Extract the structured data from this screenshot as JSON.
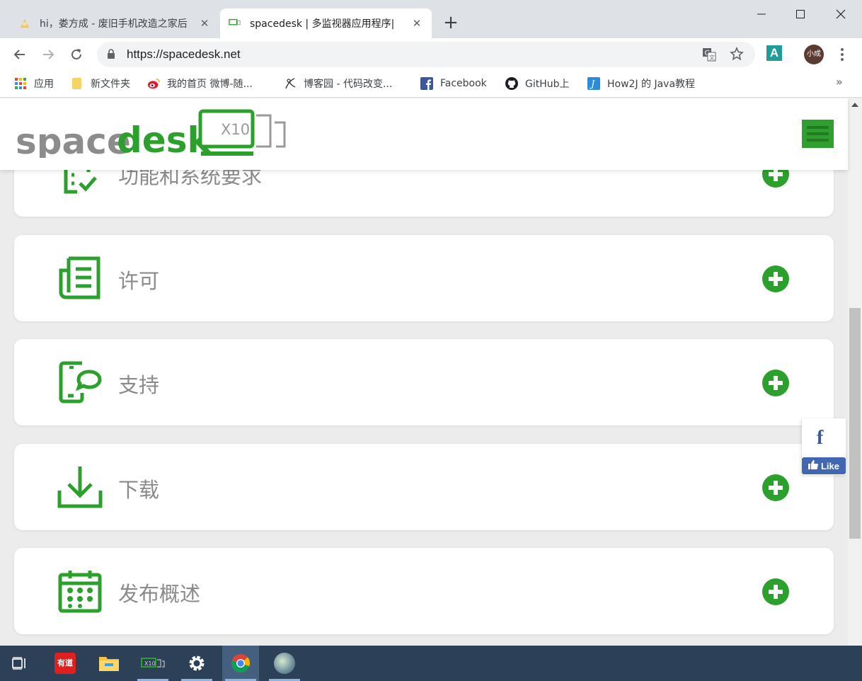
{
  "browser": {
    "tabs": [
      {
        "title": "hi，娄方成 - 废旧手机改造之家后",
        "active": false
      },
      {
        "title": "spacedesk | 多监视器应用程序|",
        "active": true
      }
    ],
    "new_tab_label": "+",
    "address": "https://spacedesk.net",
    "profile_label": "小成",
    "extension_label": "A",
    "bookmarks": [
      {
        "label": "应用",
        "icon": "apps-grid-icon"
      },
      {
        "label": "新文件夹",
        "icon": "folder-icon"
      },
      {
        "label": "我的首页 微博-随...",
        "icon": "weibo-icon"
      },
      {
        "label": "博客园 - 代码改变...",
        "icon": "cnblogs-icon"
      },
      {
        "label": "Facebook",
        "icon": "facebook-icon"
      },
      {
        "label": "GitHub上",
        "icon": "github-icon"
      },
      {
        "label": "How2J 的 Java教程",
        "icon": "how2j-icon"
      }
    ],
    "bookmarks_more": "»"
  },
  "site": {
    "logo_word_gray": "space",
    "logo_word_green": "desk",
    "logo_badge": "X10",
    "brand_color": "#2ca02c",
    "sections": [
      {
        "label": "功能和系统要求",
        "icon": "checklist-icon"
      },
      {
        "label": "许可",
        "icon": "document-icon"
      },
      {
        "label": "支持",
        "icon": "phone-chat-icon"
      },
      {
        "label": "下载",
        "icon": "download-icon"
      },
      {
        "label": "发布概述",
        "icon": "calendar-icon"
      }
    ],
    "facebook_widget": {
      "glyph": "f",
      "like_label": "Like"
    }
  },
  "taskbar": {
    "items": [
      "task-view-icon",
      "youdao-icon",
      "file-explorer-icon",
      "spacedesk-icon",
      "settings-icon",
      "chrome-icon",
      "user-photo-icon"
    ],
    "youdao_label": "有道"
  }
}
